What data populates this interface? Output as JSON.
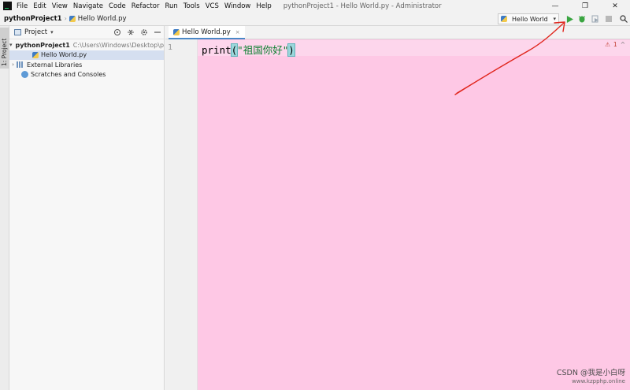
{
  "menubar": {
    "items": [
      {
        "label": "File"
      },
      {
        "label": "Edit"
      },
      {
        "label": "View"
      },
      {
        "label": "Navigate"
      },
      {
        "label": "Code"
      },
      {
        "label": "Refactor"
      },
      {
        "label": "Run"
      },
      {
        "label": "Tools"
      },
      {
        "label": "VCS"
      },
      {
        "label": "Window"
      },
      {
        "label": "Help"
      }
    ],
    "window_title": "pythonProject1 - Hello World.py - Administrator",
    "controls": {
      "minimize": "—",
      "restore": "❐",
      "close": "✕"
    }
  },
  "navbar": {
    "project": "pythonProject1",
    "separator": "›",
    "file": "Hello World.py",
    "run_config": {
      "label": "Hello World",
      "caret": "▾"
    },
    "icons": [
      "run-icon",
      "debug-icon",
      "coverage-icon",
      "stop-icon",
      "search-icon"
    ]
  },
  "side_strip": {
    "tab_label": "1: Project"
  },
  "project_panel": {
    "title": "Project",
    "caret": "▾",
    "tree": {
      "root_name": "pythonProject1",
      "root_path": "C:\\Users\\Windows\\Desktop\\p",
      "file": "Hello World.py",
      "external_libraries": "External Libraries",
      "scratches": "Scratches and Consoles"
    }
  },
  "editor": {
    "tab_label": "Hello World.py",
    "tab_close": "×",
    "line_number": "1",
    "code": {
      "fn": "print",
      "open": "(",
      "string": "\"祖国你好\"",
      "close": ")"
    },
    "inspection": {
      "count": "1",
      "warning": "⚠",
      "chevron": "^"
    }
  },
  "colors": {
    "editor_background": "#fec8e5",
    "annotation_arrow": "#e0261d",
    "run_green": "#3aa541"
  },
  "watermark": {
    "text": "CSDN @我是小白呀",
    "url": "www.kzpphp.online"
  }
}
